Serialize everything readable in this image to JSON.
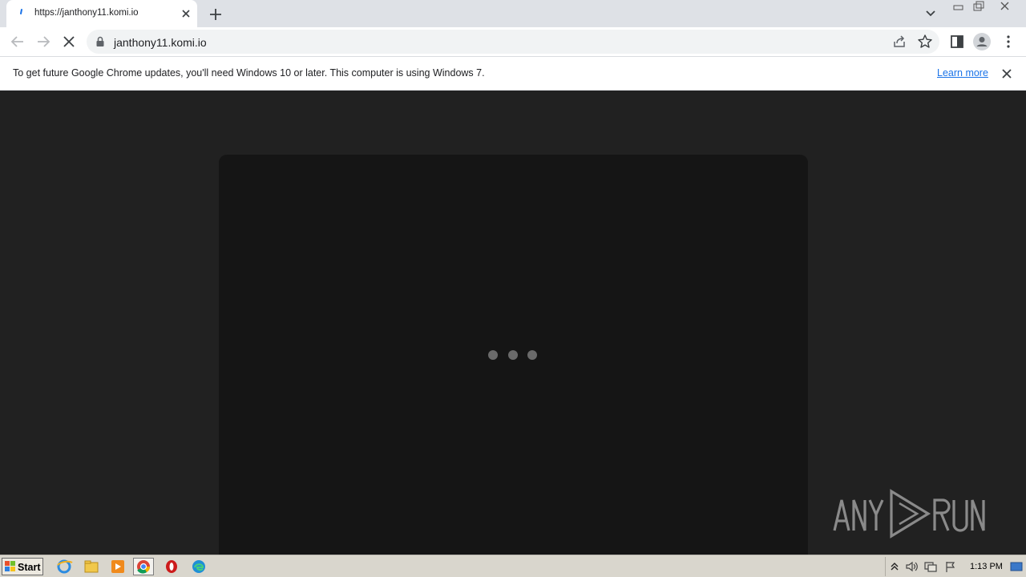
{
  "browser": {
    "tab": {
      "title": "https://janthony11.komi.io"
    },
    "url": "janthony11.komi.io"
  },
  "infobar": {
    "message": "To get future Google Chrome updates, you'll need Windows 10 or later. This computer is using Windows 7.",
    "link_label": "Learn more"
  },
  "page": {
    "loading_dots": 3,
    "watermark_text": "ANY RUN"
  },
  "taskbar": {
    "start_label": "Start",
    "clock": "1:13 PM",
    "apps": [
      "ie-icon",
      "explorer-icon",
      "media-player-icon",
      "chrome-icon",
      "opera-icon",
      "edge-icon"
    ]
  },
  "colors": {
    "page_bg": "#212121",
    "card_bg": "#151515",
    "link": "#1a73e8",
    "tabstrip": "#dee1e6"
  }
}
